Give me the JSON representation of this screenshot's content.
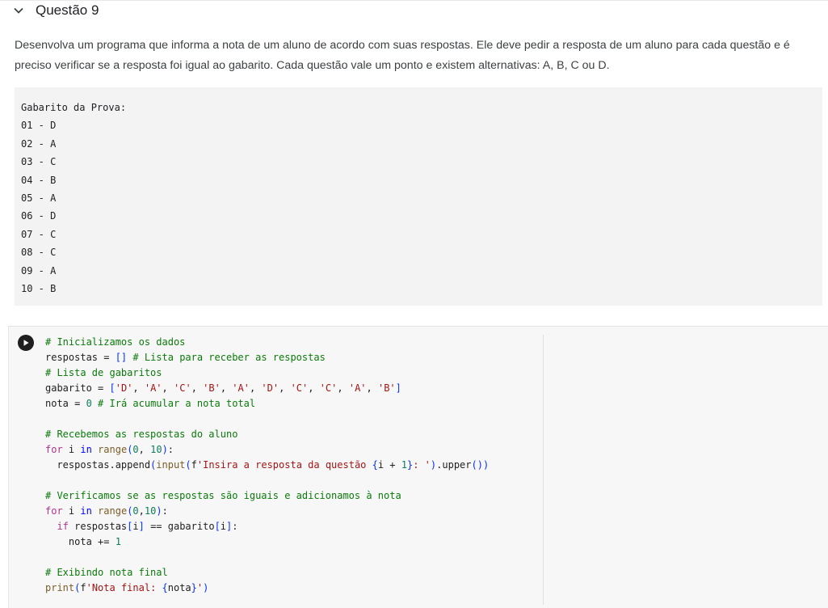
{
  "section": {
    "title": "Questão 9",
    "icon": "chevron-down-icon",
    "description": "Desenvolva um programa que informa a nota de um aluno de acordo com suas respostas. Ele deve pedir a resposta de um aluno para cada questão e é preciso verificar se a resposta foi igual ao gabarito. Cada questão vale um ponto e existem alternativas: A, B, C ou D."
  },
  "answer_key": {
    "header": "Gabarito da Prova:",
    "items": [
      "01 - D",
      "02 - A",
      "03 - C",
      "04 - B",
      "05 - A",
      "06 - D",
      "07 - C",
      "08 - C",
      "09 - A",
      "10 - B"
    ]
  },
  "code_cell": {
    "run_icon": "play-icon",
    "lines": [
      [
        {
          "t": "c",
          "v": "# Inicializamos os dados"
        }
      ],
      [
        {
          "t": "p",
          "v": "respostas = "
        },
        {
          "t": "b",
          "v": "[]"
        },
        {
          "t": "p",
          "v": " "
        },
        {
          "t": "c",
          "v": "# Lista para receber as respostas"
        }
      ],
      [
        {
          "t": "c",
          "v": "# Lista de gabaritos"
        }
      ],
      [
        {
          "t": "p",
          "v": "gabarito = "
        },
        {
          "t": "b",
          "v": "["
        },
        {
          "t": "s",
          "v": "'D'"
        },
        {
          "t": "p",
          "v": ", "
        },
        {
          "t": "s",
          "v": "'A'"
        },
        {
          "t": "p",
          "v": ", "
        },
        {
          "t": "s",
          "v": "'C'"
        },
        {
          "t": "p",
          "v": ", "
        },
        {
          "t": "s",
          "v": "'B'"
        },
        {
          "t": "p",
          "v": ", "
        },
        {
          "t": "s",
          "v": "'A'"
        },
        {
          "t": "p",
          "v": ", "
        },
        {
          "t": "s",
          "v": "'D'"
        },
        {
          "t": "p",
          "v": ", "
        },
        {
          "t": "s",
          "v": "'C'"
        },
        {
          "t": "p",
          "v": ", "
        },
        {
          "t": "s",
          "v": "'C'"
        },
        {
          "t": "p",
          "v": ", "
        },
        {
          "t": "s",
          "v": "'A'"
        },
        {
          "t": "p",
          "v": ", "
        },
        {
          "t": "s",
          "v": "'B'"
        },
        {
          "t": "b",
          "v": "]"
        }
      ],
      [
        {
          "t": "p",
          "v": "nota = "
        },
        {
          "t": "n",
          "v": "0"
        },
        {
          "t": "p",
          "v": " "
        },
        {
          "t": "c",
          "v": "# Irá acumular a nota total"
        }
      ],
      [],
      [
        {
          "t": "c",
          "v": "# Recebemos as respostas do aluno"
        }
      ],
      [
        {
          "t": "k",
          "v": "for"
        },
        {
          "t": "p",
          "v": " i "
        },
        {
          "t": "kb",
          "v": "in"
        },
        {
          "t": "p",
          "v": " "
        },
        {
          "t": "f",
          "v": "range"
        },
        {
          "t": "b",
          "v": "("
        },
        {
          "t": "n",
          "v": "0"
        },
        {
          "t": "p",
          "v": ", "
        },
        {
          "t": "n",
          "v": "10"
        },
        {
          "t": "b",
          "v": ")"
        },
        {
          "t": "p",
          "v": ":"
        }
      ],
      [
        {
          "t": "p",
          "v": "  respostas.append"
        },
        {
          "t": "b",
          "v": "("
        },
        {
          "t": "f",
          "v": "input"
        },
        {
          "t": "b",
          "v": "("
        },
        {
          "t": "p",
          "v": "f"
        },
        {
          "t": "s",
          "v": "'Insira a resposta da questão "
        },
        {
          "t": "b",
          "v": "{"
        },
        {
          "t": "p",
          "v": "i + "
        },
        {
          "t": "n",
          "v": "1"
        },
        {
          "t": "b",
          "v": "}"
        },
        {
          "t": "s",
          "v": ": '"
        },
        {
          "t": "b",
          "v": ")"
        },
        {
          "t": "p",
          "v": ".upper"
        },
        {
          "t": "b",
          "v": "())"
        }
      ],
      [],
      [
        {
          "t": "c",
          "v": "# Verificamos se as respostas são iguais e adicionamos à nota"
        }
      ],
      [
        {
          "t": "k",
          "v": "for"
        },
        {
          "t": "p",
          "v": " i "
        },
        {
          "t": "kb",
          "v": "in"
        },
        {
          "t": "p",
          "v": " "
        },
        {
          "t": "f",
          "v": "range"
        },
        {
          "t": "b",
          "v": "("
        },
        {
          "t": "n",
          "v": "0"
        },
        {
          "t": "p",
          "v": ","
        },
        {
          "t": "n",
          "v": "10"
        },
        {
          "t": "b",
          "v": ")"
        },
        {
          "t": "p",
          "v": ":"
        }
      ],
      [
        {
          "t": "p",
          "v": "  "
        },
        {
          "t": "k",
          "v": "if"
        },
        {
          "t": "p",
          "v": " respostas"
        },
        {
          "t": "b",
          "v": "["
        },
        {
          "t": "p",
          "v": "i"
        },
        {
          "t": "b",
          "v": "]"
        },
        {
          "t": "p",
          "v": " == gabarito"
        },
        {
          "t": "b",
          "v": "["
        },
        {
          "t": "p",
          "v": "i"
        },
        {
          "t": "b",
          "v": "]"
        },
        {
          "t": "p",
          "v": ":"
        }
      ],
      [
        {
          "t": "p",
          "v": "    nota += "
        },
        {
          "t": "n",
          "v": "1"
        }
      ],
      [],
      [
        {
          "t": "c",
          "v": "# Exibindo nota final"
        }
      ],
      [
        {
          "t": "f",
          "v": "print"
        },
        {
          "t": "b",
          "v": "("
        },
        {
          "t": "p",
          "v": "f"
        },
        {
          "t": "s",
          "v": "'Nota final: "
        },
        {
          "t": "b",
          "v": "{"
        },
        {
          "t": "p",
          "v": "nota"
        },
        {
          "t": "b",
          "v": "}"
        },
        {
          "t": "s",
          "v": "'"
        },
        {
          "t": "b",
          "v": ")"
        }
      ]
    ]
  }
}
